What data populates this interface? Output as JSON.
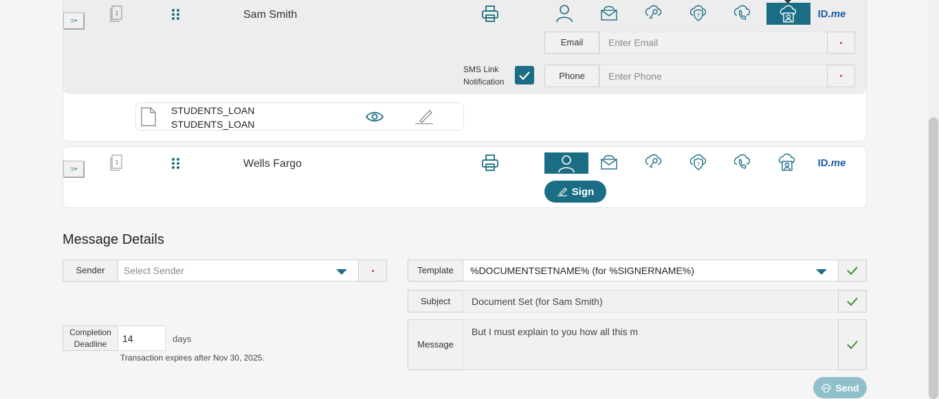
{
  "signers": [
    {
      "name": "Sam Smith",
      "doc_count": "1",
      "auth_methods": [
        "user-icon",
        "email-icon",
        "key-icon",
        "shield-question-icon",
        "phone-icon",
        "id-card-cloud-icon",
        "idme-logo"
      ],
      "active_method": "id-card-cloud-icon",
      "email_label": "Email",
      "email_placeholder": "Enter Email",
      "phone_label": "Phone",
      "phone_placeholder": "Enter Phone",
      "sms_label_line1": "SMS Link",
      "sms_label_line2": "Notification",
      "sms_checked": true,
      "document": {
        "line1": "STUDENTS_LOAN",
        "line2": "STUDENTS_LOAN"
      }
    },
    {
      "name": "Wells Fargo",
      "doc_count": "1",
      "active_method": "user-icon",
      "sign_label": "Sign"
    }
  ],
  "idme": {
    "id": "ID",
    "me": ".me"
  },
  "message_details": {
    "title": "Message Details",
    "sender_label": "Sender",
    "sender_placeholder": "Select Sender",
    "template_label": "Template",
    "template_value": "%DOCUMENTSETNAME% (for %SIGNERNAME%)",
    "subject_label": "Subject",
    "subject_value": "Document Set (for Sam Smith)",
    "message_label": "Message",
    "message_value": "But I must explain to you how all this m",
    "deadline_label_line1": "Completion",
    "deadline_label_line2": "Deadline",
    "deadline_value": "14",
    "deadline_unit": "days",
    "expiry_note": "Transaction expires after Nov 30, 2025.",
    "send_label": "Send"
  },
  "colors": {
    "accent": "#1a6d84",
    "check": "#3d8b2f",
    "required": "#c0392b",
    "idme": "#1a5ea8"
  }
}
